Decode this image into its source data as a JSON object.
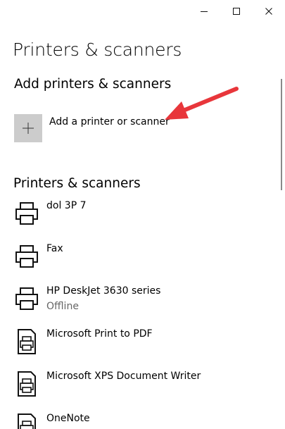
{
  "window": {
    "minimize_icon": "minimize-icon",
    "maximize_icon": "maximize-icon",
    "close_icon": "close-icon"
  },
  "page": {
    "title": "Printers & scanners"
  },
  "add_section": {
    "title": "Add printers & scanners",
    "add_button_label": "Add a printer or scanner",
    "add_icon": "plus-icon"
  },
  "annotation": {
    "color": "#e8363b",
    "icon": "red-arrow-icon"
  },
  "list_section": {
    "title": "Printers & scanners",
    "devices": [
      {
        "name": "dol 3P 7",
        "status": "",
        "icon": "printer-icon"
      },
      {
        "name": "Fax",
        "status": "",
        "icon": "printer-icon"
      },
      {
        "name": "HP DeskJet 3630 series",
        "status": "Offline",
        "icon": "printer-icon"
      },
      {
        "name": "Microsoft Print to PDF",
        "status": "",
        "icon": "document-printer-icon"
      },
      {
        "name": "Microsoft XPS Document Writer",
        "status": "",
        "icon": "document-printer-icon"
      },
      {
        "name": "OneNote",
        "status": "",
        "icon": "document-printer-icon"
      }
    ]
  }
}
